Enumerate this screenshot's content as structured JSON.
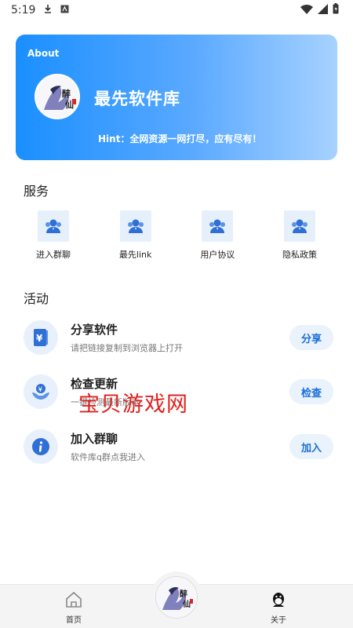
{
  "status_bar": {
    "time": "5:19"
  },
  "header": {
    "about_label": "About",
    "app_title": "最先软件库",
    "hint": "Hint：全网资源一网打尽，应有尽有！",
    "avatar_text": "醉仙"
  },
  "services": {
    "title": "服务",
    "items": [
      {
        "label": "进入群聊",
        "icon": "users-icon"
      },
      {
        "label": "最先link",
        "icon": "users-icon"
      },
      {
        "label": "用户协议",
        "icon": "users-icon"
      },
      {
        "label": "隐私政策",
        "icon": "users-icon"
      }
    ]
  },
  "activities": {
    "title": "活动",
    "items": [
      {
        "title": "分享软件",
        "subtitle": "请把链接复制到浏览器上打开",
        "button": "分享",
        "icon": "yuan-book-icon"
      },
      {
        "title": "检查更新",
        "subtitle": "一键检测最新版本",
        "button": "检查",
        "icon": "coin-hand-icon"
      },
      {
        "title": "加入群聊",
        "subtitle": "软件库q群点我进入",
        "button": "加入",
        "icon": "info-icon"
      }
    ]
  },
  "watermark": "宝贝游戏网",
  "tabbar": {
    "home_label": "首页",
    "about_label": "关于"
  },
  "colors": {
    "accent": "#1a8fff",
    "button_bg": "#eaf2fc",
    "button_text": "#1a6fd8"
  }
}
